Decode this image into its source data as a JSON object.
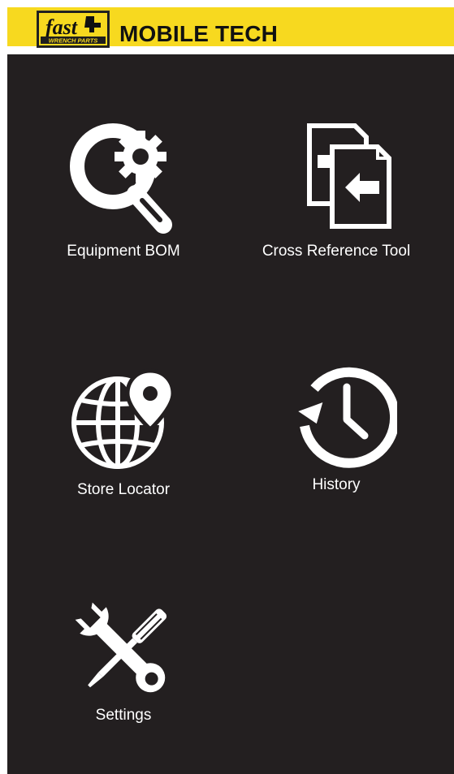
{
  "header": {
    "logo_icon": "fast-wrench-parts-logo",
    "logo_text": "fast",
    "logo_subtext": "WRENCH PARTS",
    "title": "MOBILE TECH"
  },
  "colors": {
    "header_background": "#f7d91f",
    "content_background": "#231f20",
    "icon_and_text": "#ffffff"
  },
  "menu": {
    "items": [
      {
        "label": "Equipment BOM",
        "icon": "search-gear-icon"
      },
      {
        "label": "Cross Reference Tool",
        "icon": "document-exchange-icon"
      },
      {
        "label": "Store Locator",
        "icon": "globe-location-pin-icon"
      },
      {
        "label": "History",
        "icon": "clock-history-icon"
      },
      {
        "label": "Settings",
        "icon": "wrench-screwdriver-icon"
      }
    ]
  }
}
